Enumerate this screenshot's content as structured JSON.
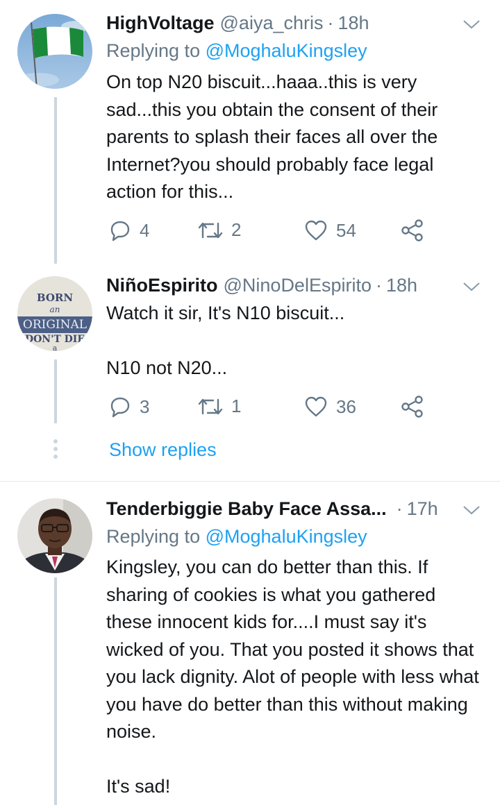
{
  "theme": {
    "accent": "#1da1f2",
    "secondary_text": "#657786",
    "primary_text": "#14171a",
    "thread_line": "#ccd6dd"
  },
  "tweets": [
    {
      "name": "HighVoltage",
      "handle": "@aiya_chris",
      "separator": "·",
      "time": "18h",
      "replying_prefix": "Replying to",
      "replying_to": "@MoghaluKingsley",
      "text": "On top N20 biscuit...haaa..this is very sad...this you obtain the consent of their parents to splash their faces all over the Internet?you should probably face legal action for this...",
      "replies": "4",
      "retweets": "2",
      "likes": "54",
      "avatar": "nigeria-flag-avatar"
    },
    {
      "name": "NiñoEspirito",
      "handle": "@NinoDelEspirito",
      "separator": "·",
      "time": "18h",
      "text": "Watch it sir, It's N10 biscuit...\n\nN10 not N20...",
      "replies": "3",
      "retweets": "1",
      "likes": "36",
      "avatar": "born-original-avatar",
      "avatar_lines": [
        "BORN",
        "an",
        "ORIGINAL",
        "DON'T DIE",
        "a"
      ],
      "show_replies": "Show replies"
    },
    {
      "name": "Tenderbiggie Baby Face Assa...",
      "separator": "·",
      "time": "17h",
      "replying_prefix": "Replying to",
      "replying_to": "@MoghaluKingsley",
      "text": "Kingsley, you can do better than this. If sharing of cookies is what you gathered these innocent kids for....I must say it's wicked of you. That you posted it shows that you lack dignity. Alot of people with less what you have do better than this without making noise.\n\nIt's sad!",
      "avatar": "man-with-glasses-avatar"
    }
  ],
  "icons": {
    "reply": "reply-icon",
    "retweet": "retweet-icon",
    "like": "heart-icon",
    "share": "share-icon",
    "menu": "chevron-down-icon"
  }
}
